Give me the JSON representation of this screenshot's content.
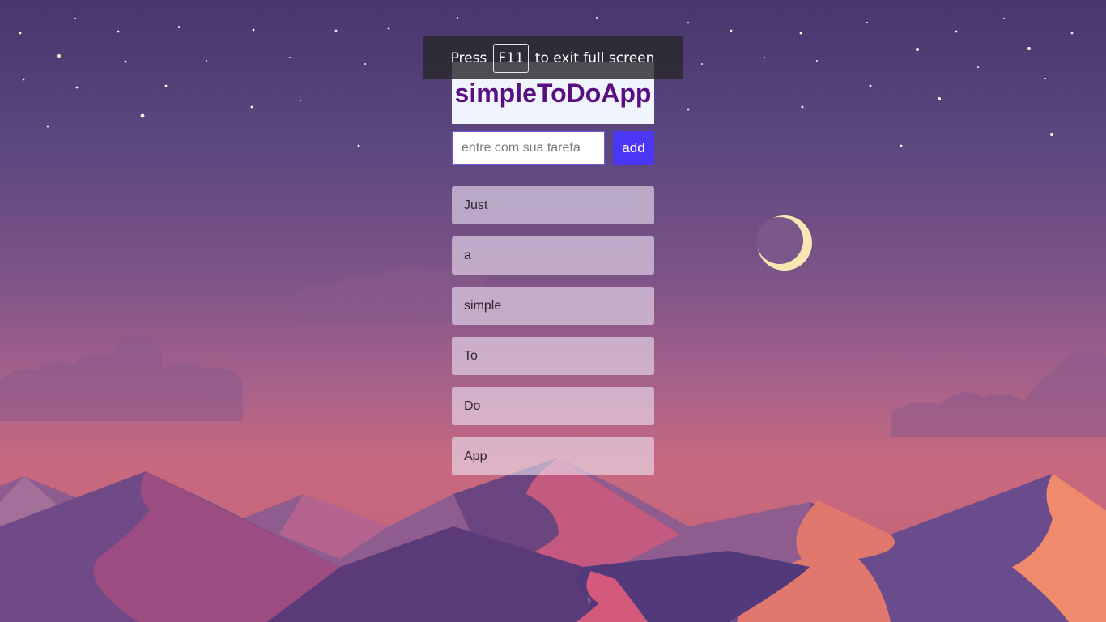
{
  "fullscreen_notice": {
    "prefix": "Press",
    "key": "F11",
    "suffix": "to exit full screen"
  },
  "app": {
    "title": "simpleToDoApp",
    "input_placeholder": "entre com sua tarefa",
    "input_value": "",
    "add_label": "add"
  },
  "todos": [
    {
      "label": "Just"
    },
    {
      "label": "a"
    },
    {
      "label": "simple"
    },
    {
      "label": "To"
    },
    {
      "label": "Do"
    },
    {
      "label": "App"
    }
  ],
  "colors": {
    "title": "#5a0f80",
    "add_button": "#4c36f6",
    "header_bg": "#f0f5fd",
    "sky_top": "#48366f",
    "sky_bottom": "#c8697f"
  },
  "background": {
    "icons": [
      "stars-decoration",
      "moon-icon",
      "clouds-decoration",
      "dunes-decoration"
    ]
  }
}
